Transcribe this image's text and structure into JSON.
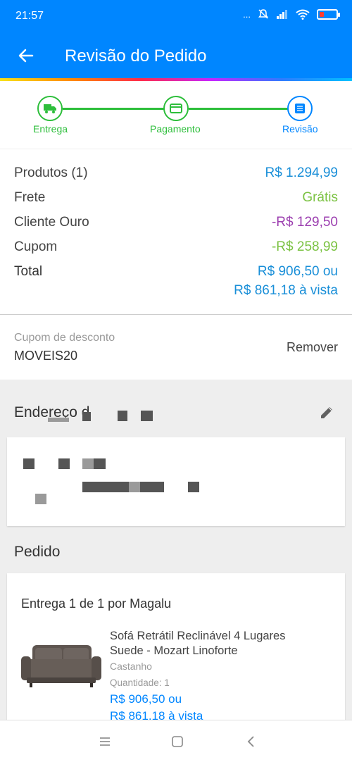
{
  "status_bar": {
    "time": "21:57",
    "dots": "..."
  },
  "app_bar": {
    "title": "Revisão do Pedido"
  },
  "steps": [
    {
      "label": "Entrega",
      "icon": "truck-icon",
      "state": "done"
    },
    {
      "label": "Pagamento",
      "icon": "card-icon",
      "state": "done"
    },
    {
      "label": "Revisão",
      "icon": "document-icon",
      "state": "current"
    }
  ],
  "summary": {
    "products_label": "Produtos (1)",
    "products_value": "R$ 1.294,99",
    "shipping_label": "Frete",
    "shipping_value": "Grátis",
    "gold_label": "Cliente Ouro",
    "gold_value": "-R$ 129,50",
    "coupon_label": "Cupom",
    "coupon_value": "-R$ 258,99",
    "total_label": "Total",
    "total_value": "R$ 906,50 ou",
    "total_cash": "R$ 861,18 à vista"
  },
  "coupon": {
    "label": "Cupom de desconto",
    "code": "MOVEIS20",
    "remove": "Remover"
  },
  "address": {
    "title_visible": "Endereço d"
  },
  "order": {
    "title": "Pedido",
    "delivery": "Entrega 1 de 1 por Magalu",
    "product": {
      "name": "Sofá Retrátil Reclinável 4 Lugares Suede - Mozart Linoforte",
      "color": "Castanho",
      "quantity": "Quantidade:  1",
      "price": "R$ 906,50 ou",
      "cash_price": "R$ 861,18 à vista"
    }
  },
  "colors": {
    "primary": "#0086ff",
    "success": "#2dbe3b",
    "value_blue": "#1a8fd8",
    "free_green": "#7bc242",
    "gold_purple": "#9c3fb0",
    "coupon_green": "#7bc242"
  }
}
